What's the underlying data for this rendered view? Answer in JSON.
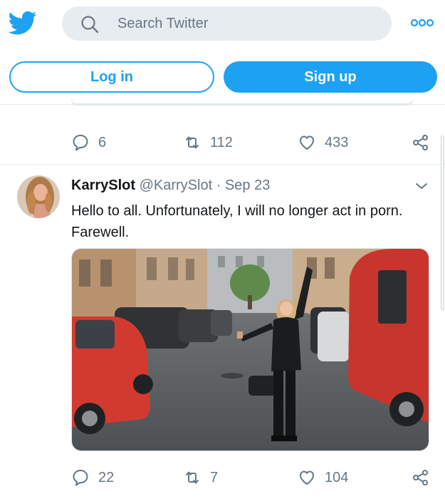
{
  "header": {
    "logo_icon": "twitter-bird-icon",
    "search_placeholder": "Search Twitter",
    "search_icon": "search-icon",
    "more_icon": "more-dots-icon"
  },
  "auth": {
    "login_label": "Log in",
    "signup_label": "Sign up"
  },
  "previous_tweet": {
    "replies": "6",
    "retweets": "112",
    "likes": "433"
  },
  "tweet": {
    "display_name": "KarrySlot",
    "handle": "@KarrySlot",
    "separator": "·",
    "date": "Sep 23",
    "text": "Hello to all.  Unfortunately, I will no longer act in porn. Farewell.",
    "replies": "22",
    "retweets": "7",
    "likes": "104"
  },
  "colors": {
    "brand_blue": "#1da1f2",
    "muted_text": "#657786",
    "divider": "#e1e8ed",
    "search_bg": "#e6ecf0"
  }
}
